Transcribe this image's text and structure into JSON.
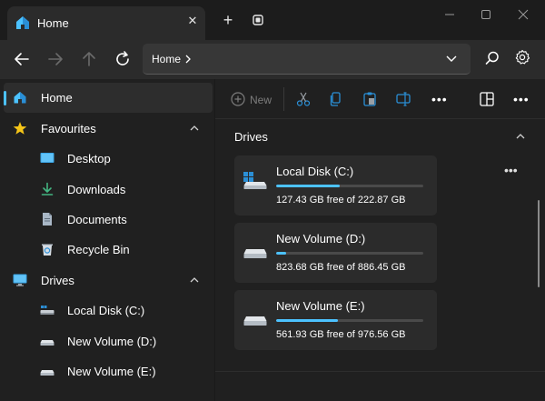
{
  "tab": {
    "title": "Home",
    "icon": "home-icon"
  },
  "titlebar": {
    "new_tab_label": "+",
    "close_tab_glyph": "✕"
  },
  "address": {
    "text": "Home"
  },
  "sidebar": {
    "items": [
      {
        "label": "Home",
        "icon": "home-icon",
        "active": true
      },
      {
        "label": "Favourites",
        "icon": "star-icon",
        "expandable": true
      },
      {
        "label": "Desktop",
        "icon": "desktop-icon"
      },
      {
        "label": "Downloads",
        "icon": "download-icon"
      },
      {
        "label": "Documents",
        "icon": "document-icon"
      },
      {
        "label": "Recycle Bin",
        "icon": "recycle-bin-icon"
      },
      {
        "label": "Drives",
        "icon": "monitor-icon",
        "expandable": true
      },
      {
        "label": "Local Disk (C:)",
        "icon": "system-drive-icon"
      },
      {
        "label": "New Volume (D:)",
        "icon": "drive-icon"
      },
      {
        "label": "New Volume (E:)",
        "icon": "drive-icon"
      }
    ]
  },
  "toolbar": {
    "new_label": "New",
    "more_glyph": "•••"
  },
  "section": {
    "title": "Drives",
    "more_glyph": "•••"
  },
  "drives": [
    {
      "name": "Local Disk (C:)",
      "free_text": "127.43 GB free of 222.87 GB",
      "used_fraction": 0.43
    },
    {
      "name": "New Volume (D:)",
      "free_text": "823.68 GB free of 886.45 GB",
      "used_fraction": 0.07
    },
    {
      "name": "New Volume (E:)",
      "free_text": "561.93 GB free of 976.56 GB",
      "used_fraction": 0.42
    }
  ],
  "colors": {
    "accent": "#4cc2ff",
    "background": "#202020",
    "card": "#2b2b2b"
  }
}
